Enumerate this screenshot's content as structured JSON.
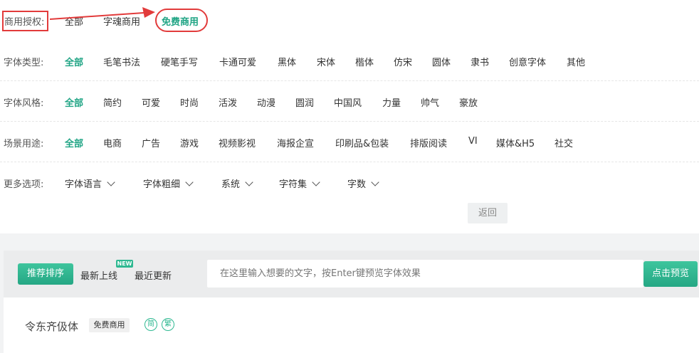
{
  "filters": {
    "license": {
      "label": "商用授权:",
      "options": [
        "全部",
        "字魂商用",
        "免费商用"
      ],
      "active": 2
    },
    "type": {
      "label": "字体类型:",
      "options": [
        "全部",
        "毛笔书法",
        "硬笔手写",
        "卡通可爱",
        "黑体",
        "宋体",
        "楷体",
        "仿宋",
        "圆体",
        "隶书",
        "创意字体",
        "其他"
      ],
      "active": 0
    },
    "style": {
      "label": "字体风格:",
      "options": [
        "全部",
        "简约",
        "可爱",
        "时尚",
        "活泼",
        "动漫",
        "圆润",
        "中国风",
        "力量",
        "帅气",
        "豪放"
      ],
      "active": 0
    },
    "scene": {
      "label": "场景用途:",
      "options": [
        "全部",
        "电商",
        "广告",
        "游戏",
        "视频影视",
        "海报企宣",
        "印刷品&包装",
        "排版阅读",
        "VI",
        "媒体&H5",
        "社交"
      ],
      "active": 0
    },
    "more": {
      "label": "更多选项:",
      "dropdowns": [
        "字体语言",
        "字体粗细",
        "系统",
        "字符集",
        "字数"
      ]
    }
  },
  "back_label": "返回",
  "sort": {
    "recommended": "推荐排序",
    "newest": "最新上线",
    "new_badge": "NEW",
    "recent": "最近更新"
  },
  "search": {
    "placeholder": "在这里输入想要的文字，按Enter键预览字体效果",
    "button": "点击预览"
  },
  "font_item": {
    "name": "令东齐伋体",
    "tag": "免费商用",
    "simplified": "简",
    "traditional": "繁"
  },
  "colors": {
    "accent": "#1fa484",
    "highlight": "#e23b3b"
  }
}
